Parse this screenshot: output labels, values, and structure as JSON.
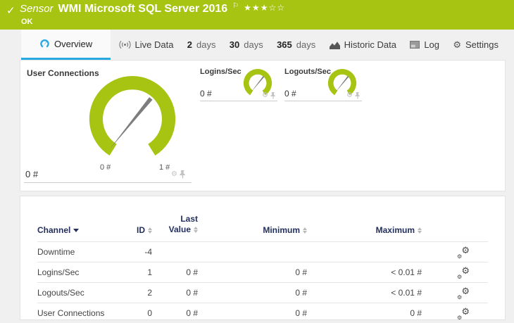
{
  "colors": {
    "status_green": "#a8c413",
    "accent_blue": "#29a9e1",
    "table_header_navy": "#232f5c"
  },
  "icons": {
    "gear": "⚙",
    "check": "✓",
    "flag": "⚐"
  },
  "header": {
    "kind": "Sensor",
    "title": "WMI Microsoft SQL Server 2016",
    "status": "OK",
    "stars_filled": "★★★",
    "stars_empty": "☆☆"
  },
  "tabs": {
    "overview": {
      "label": "Overview"
    },
    "live": {
      "label": "Live Data"
    },
    "d2": {
      "num": "2",
      "unit": "days"
    },
    "d30": {
      "num": "30",
      "unit": "days"
    },
    "d365": {
      "num": "365",
      "unit": "days"
    },
    "historic": {
      "label": "Historic Data"
    },
    "log": {
      "label": "Log"
    },
    "settings": {
      "label": "Settings"
    }
  },
  "gauges": {
    "main": {
      "title": "User Connections",
      "value": "0 #",
      "scale_min": "0 #",
      "scale_max": "1 #"
    },
    "logins": {
      "title": "Logins/Sec",
      "value": "0 #"
    },
    "logouts": {
      "title": "Logouts/Sec",
      "value": "0 #"
    }
  },
  "chart_data": {
    "type": "gauge-set",
    "gauges": [
      {
        "title": "User Connections",
        "value": 0,
        "unit": "#",
        "min": 0,
        "max": 1
      },
      {
        "title": "Logins/Sec",
        "value": 0,
        "unit": "#"
      },
      {
        "title": "Logouts/Sec",
        "value": 0,
        "unit": "#"
      }
    ]
  },
  "table": {
    "headers": {
      "channel": "Channel",
      "id": "ID",
      "last_l1": "Last",
      "last_l2": "Value",
      "minimum": "Minimum",
      "maximum": "Maximum"
    },
    "rows": [
      {
        "channel": "Downtime",
        "id": "-4",
        "last": "",
        "min": "",
        "max": ""
      },
      {
        "channel": "Logins/Sec",
        "id": "1",
        "last": "0 #",
        "min": "0 #",
        "max": "< 0.01 #"
      },
      {
        "channel": "Logouts/Sec",
        "id": "2",
        "last": "0 #",
        "min": "0 #",
        "max": "< 0.01 #"
      },
      {
        "channel": "User Connections",
        "id": "0",
        "last": "0 #",
        "min": "0 #",
        "max": "0 #"
      }
    ]
  }
}
